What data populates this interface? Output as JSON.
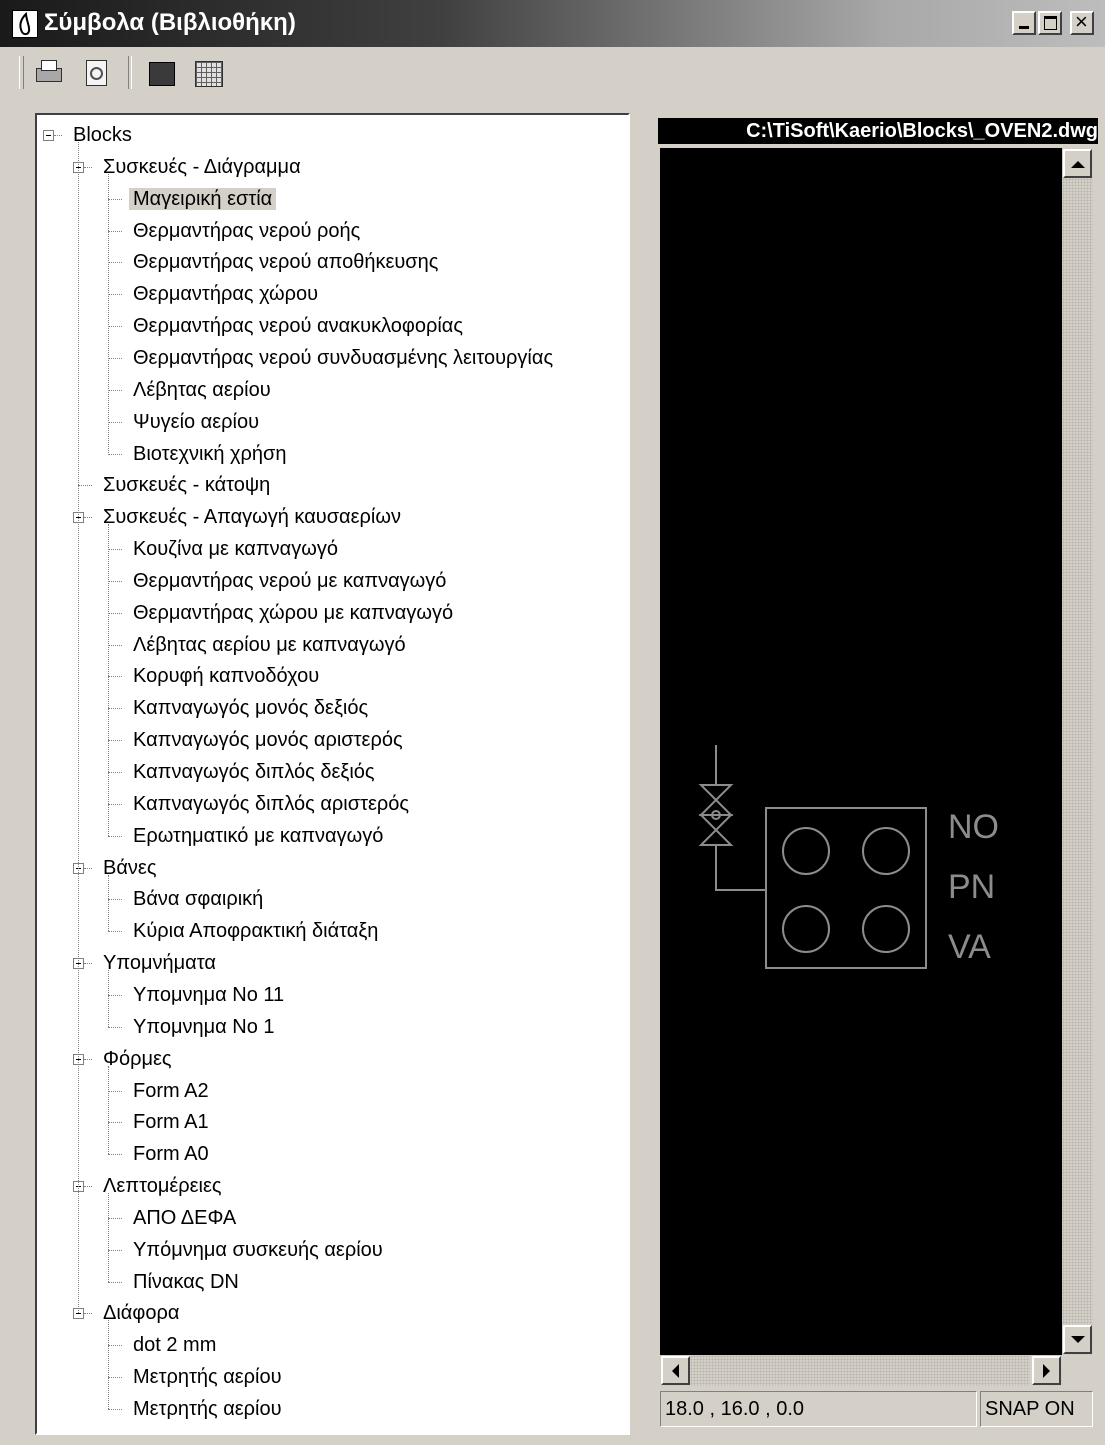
{
  "window": {
    "title": "Σύμβολα (Βιβλιοθήκη)"
  },
  "toolbar": {
    "icons": [
      "print-icon",
      "preview-icon",
      "fill-icon",
      "grid-icon"
    ]
  },
  "tree": {
    "root": "Blocks",
    "rows": [
      {
        "label": "Blocks",
        "level": 0,
        "expandable": true
      },
      {
        "label": "Συσκευές - Διάγραμμα",
        "level": 1,
        "expandable": true
      },
      {
        "label": "Μαγειρική εστία",
        "level": 2,
        "selected": true
      },
      {
        "label": "Θερμαντήρας νερού ροής",
        "level": 2
      },
      {
        "label": "Θερμαντήρας νερού αποθήκευσης",
        "level": 2
      },
      {
        "label": "Θερμαντήρας χώρου",
        "level": 2
      },
      {
        "label": "Θερμαντήρας νερού ανακυκλοφορίας",
        "level": 2
      },
      {
        "label": "Θερμαντήρας νερού συνδυασμένης λειτουργίας",
        "level": 2
      },
      {
        "label": "Λέβητας αερίου",
        "level": 2
      },
      {
        "label": "Ψυγείο αερίου",
        "level": 2
      },
      {
        "label": "Βιοτεχνική χρήση",
        "level": 2
      },
      {
        "label": "Συσκευές - κάτοψη",
        "level": 1
      },
      {
        "label": "Συσκευές - Απαγωγή καυσαερίων",
        "level": 1,
        "expandable": true
      },
      {
        "label": "Κουζίνα με καπναγωγό",
        "level": 2
      },
      {
        "label": "Θερμαντήρας νερού με καπναγωγό",
        "level": 2
      },
      {
        "label": "Θερμαντήρας χώρου με καπναγωγό",
        "level": 2
      },
      {
        "label": "Λέβητας αερίου με καπναγωγό",
        "level": 2
      },
      {
        "label": "Κορυφή καπνοδόχου",
        "level": 2
      },
      {
        "label": "Καπναγωγός μονός δεξιός",
        "level": 2
      },
      {
        "label": "Καπναγωγός μονός αριστερός",
        "level": 2
      },
      {
        "label": "Καπναγωγός διπλός δεξιός",
        "level": 2
      },
      {
        "label": "Καπναγωγός διπλός αριστερός",
        "level": 2
      },
      {
        "label": "Ερωτηματικό με καπναγωγό",
        "level": 2
      },
      {
        "label": "Βάνες",
        "level": 1,
        "expandable": true
      },
      {
        "label": "Βάνα σφαιρική",
        "level": 2
      },
      {
        "label": "Κύρια Αποφρακτική διάταξη",
        "level": 2
      },
      {
        "label": "Υπομνήματα",
        "level": 1,
        "expandable": true
      },
      {
        "label": "Υπομνημα Νο 11",
        "level": 2
      },
      {
        "label": "Υπομνημα Νο 1",
        "level": 2
      },
      {
        "label": "Φόρμες",
        "level": 1,
        "expandable": true
      },
      {
        "label": "Form A2",
        "level": 2
      },
      {
        "label": "Form A1",
        "level": 2
      },
      {
        "label": "Form A0",
        "level": 2
      },
      {
        "label": "Λεπτομέρειες",
        "level": 1,
        "expandable": true
      },
      {
        "label": "ΑΠΟ ΔΕΦΑ",
        "level": 2
      },
      {
        "label": "Υπόμνημα συσκευής αερίου",
        "level": 2
      },
      {
        "label": "Πίνακας DN",
        "level": 2
      },
      {
        "label": "Διάφορα",
        "level": 1,
        "expandable": true
      },
      {
        "label": "dot 2 mm",
        "level": 2
      },
      {
        "label": "Μετρητής αερίου",
        "level": 2
      },
      {
        "label": "Μετρητής αερίου",
        "level": 2
      }
    ]
  },
  "preview": {
    "path": "C:\\TiSoft\\Kaerio\\Blocks\\_OVEN2.dwg",
    "symbol_labels": [
      "NO",
      "PN",
      "VA"
    ],
    "coords": "18.0 , 16.0 , 0.0",
    "snap": "SNAP ON"
  },
  "colors": {
    "canvas_bg": "#000000",
    "drawing_stroke": "#8c8c8c",
    "window_bg": "#d4d0c8"
  }
}
